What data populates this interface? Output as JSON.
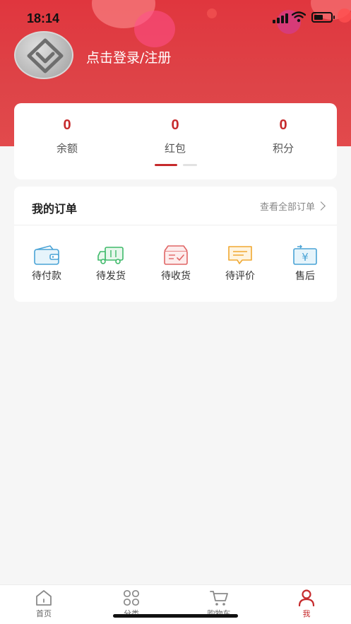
{
  "status_bar": {
    "time": "18:14"
  },
  "profile": {
    "login_text": "点击登录/注册"
  },
  "stats": [
    {
      "value": "0",
      "label": "余额"
    },
    {
      "value": "0",
      "label": "红包"
    },
    {
      "value": "0",
      "label": "积分"
    }
  ],
  "orders": {
    "title": "我的订单",
    "view_all": "查看全部订单",
    "items": [
      {
        "label": "待付款",
        "icon": "wallet-icon"
      },
      {
        "label": "待发货",
        "icon": "delivery-truck-icon"
      },
      {
        "label": "待收货",
        "icon": "receive-box-icon"
      },
      {
        "label": "待评价",
        "icon": "comment-icon"
      },
      {
        "label": "售后",
        "icon": "refund-icon"
      }
    ]
  },
  "tab_bar": {
    "items": [
      {
        "label": "首页",
        "icon": "home-icon"
      },
      {
        "label": "分类",
        "icon": "category-icon"
      },
      {
        "label": "购物车",
        "icon": "cart-icon"
      },
      {
        "label": "我",
        "icon": "profile-icon",
        "active": true
      }
    ],
    "active_color": "#c62a2c"
  },
  "colors": {
    "brand_red": "#e0363e",
    "accent": "#c62a2c"
  }
}
